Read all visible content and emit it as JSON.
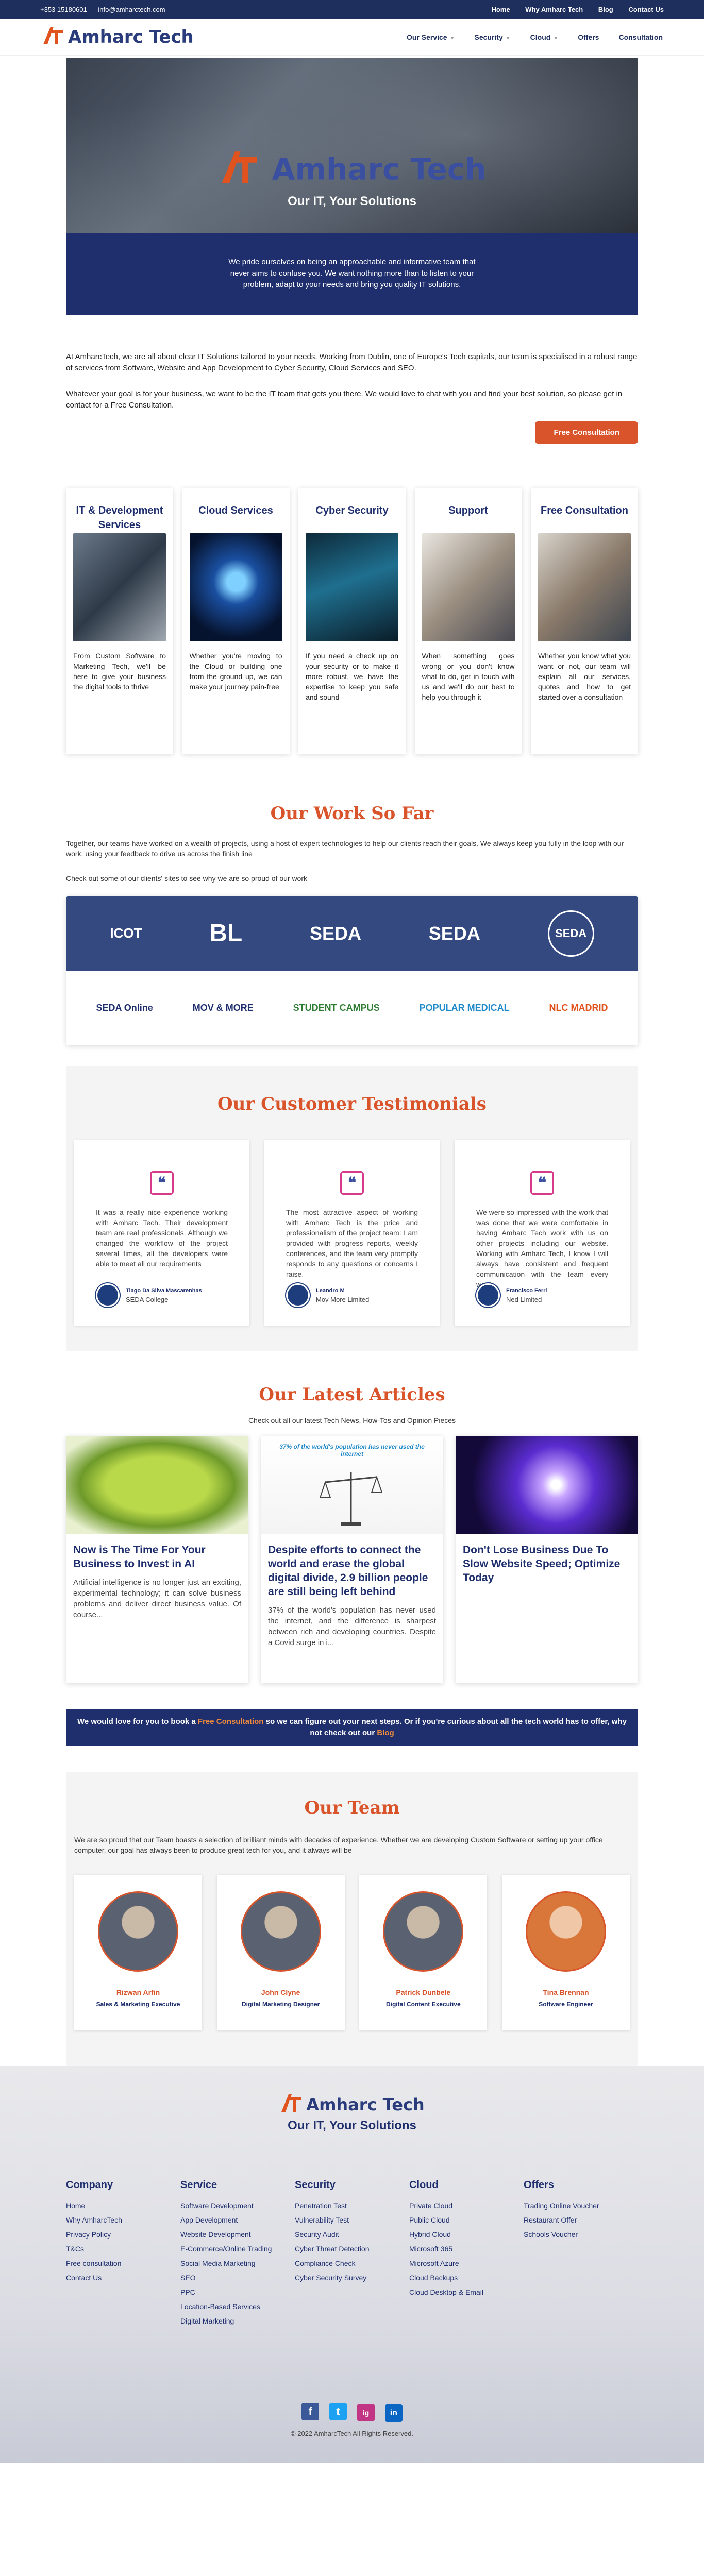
{
  "topbar": {
    "phone": "+353 15180601",
    "email": "info@amharctech.com",
    "links": [
      "Home",
      "Why Amharc Tech",
      "Blog",
      "Contact Us"
    ]
  },
  "brand": {
    "name": "Amharc Tech",
    "mark": "AT"
  },
  "nav": {
    "items": [
      "Our Service",
      "Security",
      "Cloud",
      "Offers",
      "Consultation"
    ]
  },
  "hero": {
    "tagline": "Our IT, Your Solutions",
    "text": "We pride ourselves on being an approachable and informative team that never aims to confuse you. We want nothing more than to listen to your problem, adapt to your needs and bring you quality IT solutions."
  },
  "intro": {
    "p1": "At AmharcTech, we are all about clear IT Solutions tailored to your needs. Working from Dublin, one of Europe's Tech capitals, our team is specialised in a robust range of services from Software, Website and App Development to Cyber Security, Cloud Services and SEO.",
    "p2": "Whatever your goal is for your business, we want to be the IT team that gets you there. We would love to chat with you and find your best solution, so please get in contact for a Free Consultation.",
    "cta": "Free Consultation"
  },
  "services": [
    {
      "title": "IT & Development Services",
      "text": "From Custom Software to Marketing Tech, we'll be here to give your business the digital tools to thrive"
    },
    {
      "title": "Cloud Services",
      "text": "Whether you're moving to the Cloud or building one from the ground up, we can make your journey pain-free"
    },
    {
      "title": "Cyber Security",
      "text": "If you need a check up on your security or to make it more robust, we have the expertise to keep you safe and sound"
    },
    {
      "title": "Support",
      "text": "When something goes wrong or you don't know what to do, get in touch with us and we'll do our best to help you through it"
    },
    {
      "title": "Free Consultation",
      "text": "Whether you know what you want or not, our team will explain all our services, quotes and how to get started over a consultation"
    }
  ],
  "work": {
    "title": "Our Work So Far",
    "p1": "Together, our teams have worked on a wealth of projects, using a host of expert technologies to help our clients reach their goals. We always keep you fully in the loop with our work, using your feedback to drive us across the finish line",
    "p2": "Check out some of our clients' sites to see why we are so proud of our work",
    "clients_top": [
      "ICOT",
      "BL",
      "SEDA",
      "SEDA",
      "SEDA"
    ],
    "clients_bottom": [
      "SEDA Online",
      "MOV & MORE",
      "STUDENT CAMPUS",
      "POPULAR MEDICAL",
      "NLC MADRID"
    ]
  },
  "testimonials": {
    "title": "Our Customer Testimonials",
    "items": [
      {
        "text": "It was a really nice experience working with Amharc Tech. Their development team are real professionals. Although we changed the workflow of the project several times, all the developers were able to meet all our requirements",
        "name": "Tiago Da Silva Mascarenhas",
        "org": "SEDA College"
      },
      {
        "text": "The most attractive aspect of working with Amharc Tech is the price and professionalism of the project team: I am provided with progress reports, weekly conferences, and the team very promptly responds to any questions or concerns I raise.",
        "name": "Leandro M",
        "org": "Mov More Limited"
      },
      {
        "text": "We were so impressed with the work that was done that we were comfortable in having Amharc Tech work with us on other projects including our website. Working with Amharc Tech, I know I will always have consistent and frequent communication with the team every week.",
        "name": "Francisco Ferri",
        "org": "Ned Limited"
      }
    ]
  },
  "articles": {
    "title": "Our Latest Articles",
    "sub": "Check out all our latest Tech News, How-Tos and Opinion Pieces",
    "items": [
      {
        "title": "Now is The Time For Your Business to Invest in AI",
        "text": "Artificial intelligence is no longer just an exciting, experimental technology; it can solve business problems and deliver direct business value. Of course..."
      },
      {
        "title": "Despite efforts to connect the world and erase the global digital divide, 2.9 billion people are still being left behind",
        "text": "37% of the world's population has never used the internet, and the difference is sharpest between rich and developing countries. Despite a Covid surge in i...",
        "img_caption": "37% of the world's population has never used the internet"
      },
      {
        "title": "Don't Lose Business Due To Slow Website Speed; Optimize Today",
        "text": ""
      }
    ]
  },
  "banner": {
    "pre": "We would love for you to book a ",
    "link1": "Free Consultation",
    "mid": " so we can figure out your next steps. Or if you're curious about all the tech world has to offer, why not check out our ",
    "link2": "Blog"
  },
  "team": {
    "title": "Our Team",
    "desc": "We are so proud that our Team boasts a selection of brilliant minds with decades of experience. Whether we are developing Custom Software or setting up your office computer, our goal has always been to produce great tech for you, and it always will be",
    "members": [
      {
        "name": "Rizwan Arfin",
        "role": "Sales & Marketing Executive"
      },
      {
        "name": "John Clyne",
        "role": "Digital Marketing Designer"
      },
      {
        "name": "Patrick Dunbele",
        "role": "Digital Content Executive"
      },
      {
        "name": "Tina Brennan",
        "role": "Software Engineer"
      }
    ]
  },
  "footer": {
    "tagline": "Our IT, Your Solutions",
    "cols": [
      {
        "title": "Company",
        "links": [
          "Home",
          "Why AmharcTech",
          "Privacy Policy",
          "T&Cs",
          "Free consultation",
          "Contact Us"
        ]
      },
      {
        "title": "Service",
        "links": [
          "Software Development",
          "App Development",
          "Website Development",
          "E-Commerce/Online Trading",
          "Social Media Marketing",
          "SEO",
          "PPC",
          "Location-Based Services",
          "Digital Marketing"
        ]
      },
      {
        "title": "Security",
        "links": [
          "Penetration Test",
          "Vulnerability Test",
          "Security Audit",
          "Cyber Threat Detection",
          "Compliance Check",
          "Cyber Security Survey"
        ]
      },
      {
        "title": "Cloud",
        "links": [
          "Private Cloud",
          "Public Cloud",
          "Hybrid Cloud",
          "Microsoft 365",
          "Microsoft Azure",
          "Cloud Backups",
          "Cloud Desktop & Email"
        ]
      },
      {
        "title": "Offers",
        "links": [
          "Trading Online Voucher",
          "Restaurant Offer",
          "Schools Voucher"
        ]
      }
    ],
    "social": [
      "f",
      "t",
      "ig",
      "in"
    ],
    "copyright": "© 2022 AmharcTech All Rights Reserved."
  }
}
